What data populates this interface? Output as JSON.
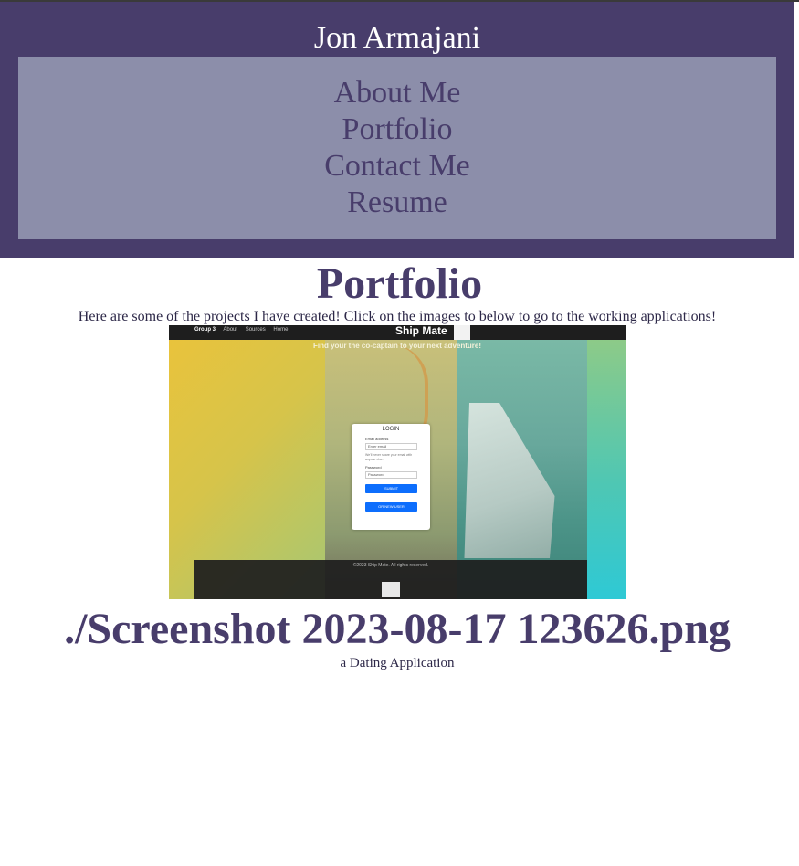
{
  "header": {
    "title": "Jon Armajani",
    "nav": [
      "About Me",
      "Portfolio",
      "Contact Me",
      "Resume"
    ]
  },
  "main": {
    "section_title": "Portfolio",
    "intro": "Here are some of the projects I have created! Click on the images to below to go to the working applications!",
    "project": {
      "thumbnail": {
        "nav_links": [
          "Group 3",
          "About",
          "Sources",
          "Home"
        ],
        "brand": "Ship Mate",
        "tagline": "Find your the co-captain to your next adventure!",
        "login_title": "LOGIN",
        "email_label": "Email address",
        "email_placeholder": "Enter email",
        "email_hint": "We'll never share your email with anyone else.",
        "password_label": "Password",
        "password_placeholder": "Password",
        "submit_label": "SUBMIT",
        "new_user_label": "OR NEW USER",
        "footer_text": "©2023 Ship Mate. All rights reserved."
      },
      "title": "./Screenshot 2023-08-17 123626.png",
      "description": "a Dating Application"
    }
  },
  "colors": {
    "header_bg": "#483d6b",
    "nav_bg": "#8c8eaa",
    "text_purple": "#483d6b"
  }
}
